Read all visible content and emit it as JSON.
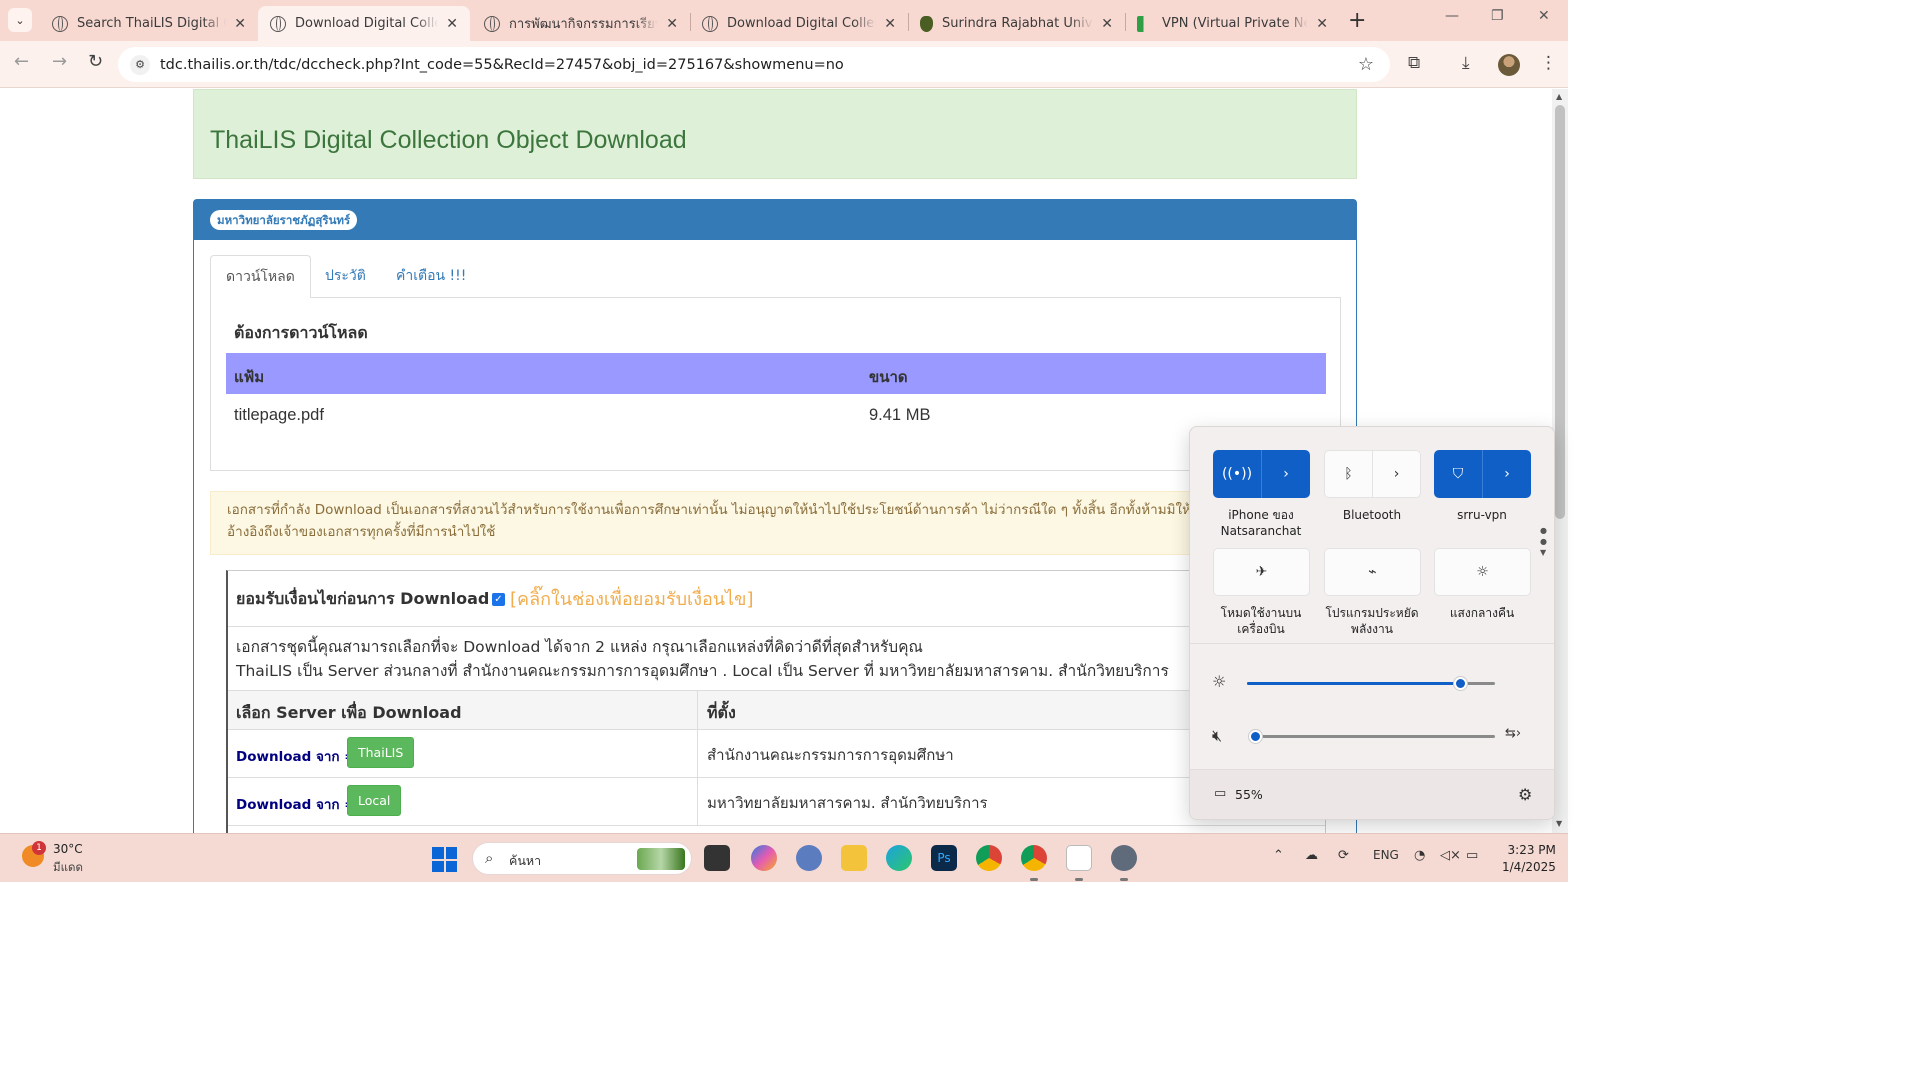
{
  "browser": {
    "tabs": [
      {
        "title": "Search ThaiLIS Digital Colle",
        "active": false
      },
      {
        "title": "Download Digital Collectio",
        "active": true
      },
      {
        "title": "การพัฒนากิจกรรมการเรียนรู้ตา",
        "active": false
      },
      {
        "title": "Download Digital Collectio",
        "active": false
      },
      {
        "title": "Surindra Rajabhat Universi",
        "active": false
      },
      {
        "title": "VPN (Virtual Private Netwo",
        "active": false
      }
    ],
    "url": "tdc.thailis.or.th/tdc/dccheck.php?Int_code=55&RecId=27457&obj_id=275167&showmenu=no"
  },
  "page": {
    "title": "ThaiLIS Digital Collection Object Download",
    "university_badge": "มหาวิทยาลัยราชภัฏสุรินทร์",
    "tabs": [
      "ดาวน์โหลด",
      "ประวัติ",
      "คำเตือน !!!"
    ],
    "download_heading": "ต้องการดาวน์โหลด",
    "file_table": {
      "headers": [
        "แฟ้ม",
        "ขนาด"
      ],
      "rows": [
        {
          "file": "titlepage.pdf",
          "size": "9.41 MB"
        }
      ]
    },
    "notice_line1": "เอกสารที่กำลัง Download เป็นเอกสารที่สงวนไว้สำหรับการใช้งานเพื่อการศึกษาเท่านั้น ไม่อนุญาตให้นำไปใช้ประโยชน์ด้านการค้า ไม่ว่ากรณีใด ๆ ทั้งสิ้น อีกทั้งห้ามมิให้",
    "notice_line2": "อ้างอิงถึงเจ้าของเอกสารทุกครั้งที่มีการนำไปใช้",
    "accept_label": "ยอมรับเงื่อนไขก่อนการ Download",
    "accept_hint": "[คลิ๊กในช่องเพื่อยอมรับเงื่อนไข]",
    "desc_line1": "เอกสารชุดนี้คุณสามารถเลือกที่จะ Download ได้จาก 2 แหล่ง กรุณาเลือกแหล่งที่คิดว่าดีที่สุดสำหรับคุณ",
    "desc_line2": "ThaiLIS เป็น Server ส่วนกลางที่ สำนักงานคณะกรรมการการอุดมศึกษา . Local เป็น Server ที่ มหาวิทยาลัยมหาสารคาม. สำนักวิทยบริการ",
    "server_table": {
      "headers": [
        "เลือก Server เพื่อ Download",
        "ที่ตั้ง"
      ],
      "download_from": "Download จาก =>",
      "rows": [
        {
          "button": "ThaiLIS",
          "location": "สำนักงานคณะกรรมการการอุดมศึกษา"
        },
        {
          "button": "Local",
          "location": "มหาวิทยาลัยมหาสารคาม. สำนักวิทยบริการ"
        }
      ]
    }
  },
  "quick_settings": {
    "tiles": [
      {
        "label": "iPhone ของ Natsaranchat",
        "icon": "wifi-icon",
        "on": true
      },
      {
        "label": "Bluetooth",
        "icon": "bluetooth-icon",
        "on": false
      },
      {
        "label": "srru-vpn",
        "icon": "vpn-shield-icon",
        "on": true
      },
      {
        "label": "โหมดใช้งานบนเครื่องบิน",
        "icon": "airplane-icon",
        "on": false
      },
      {
        "label": "โปรแกรมประหยัดพลังงาน",
        "icon": "battery-saver-icon",
        "on": false
      },
      {
        "label": "แสงกลางคืน",
        "icon": "night-light-icon",
        "on": false
      }
    ],
    "brightness": 0.86,
    "volume": 0.0,
    "battery": "55%"
  },
  "taskbar": {
    "weather_temp": "30°C",
    "weather_desc": "มีแดด",
    "weather_badge": "1",
    "search_placeholder": "ค้นหา",
    "language": "ENG",
    "time": "3:23 PM",
    "date": "1/4/2025"
  }
}
